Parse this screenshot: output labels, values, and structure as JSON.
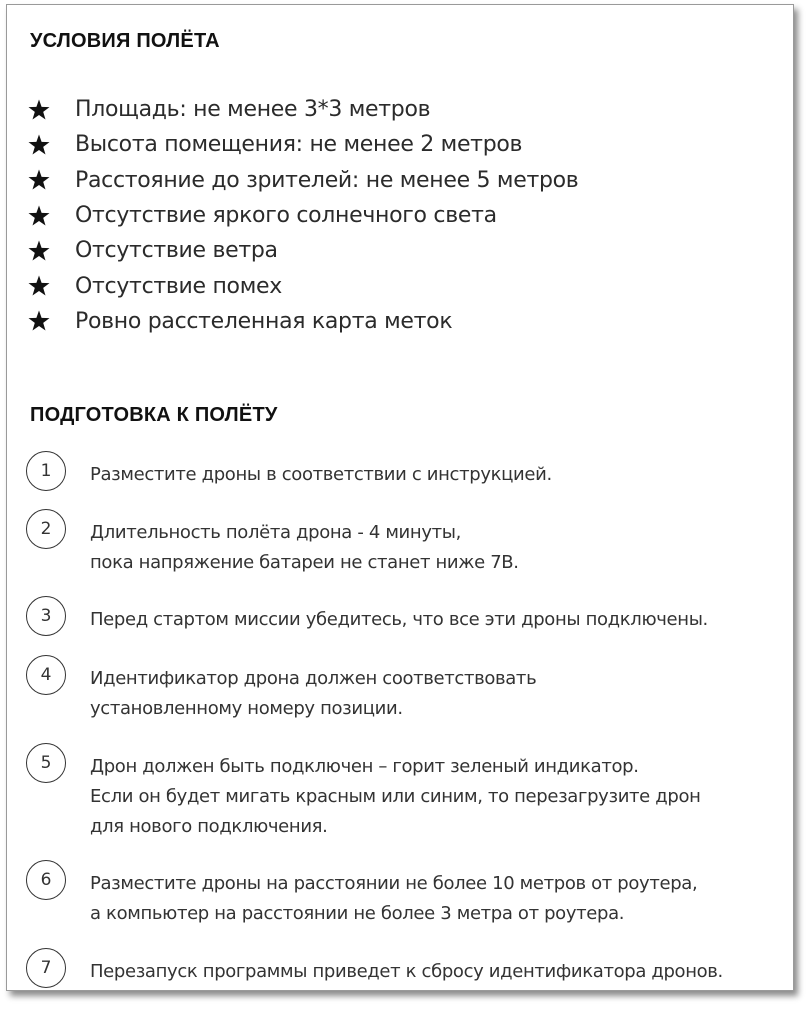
{
  "flight_conditions": {
    "title": "УСЛОВИЯ ПОЛЁТА",
    "icon": "star-icon",
    "items": [
      "Площадь: не менее 3*3 метров",
      "Высота помещения: не менее 2 метров",
      "Расстояние до зрителей: не менее 5 метров",
      "Отсутствие яркого солнечного света",
      "Отсутствие ветра",
      "Отсутствие помех",
      "Ровно расстеленная карта меток"
    ]
  },
  "flight_preparation": {
    "title": "ПОДГОТОВКА К ПОЛЁТУ",
    "steps": [
      {
        "number": "1",
        "lines": [
          "Разместите дроны в соответствии с инструкцией."
        ]
      },
      {
        "number": "2",
        "lines": [
          "Длительность полёта дрона - 4 минуты,",
          "пока напряжение батареи не станет ниже 7В."
        ]
      },
      {
        "number": "3",
        "lines": [
          "Перед стартом миссии убедитесь, что все эти дроны подключены."
        ]
      },
      {
        "number": "4",
        "lines": [
          "Идентификатор дрона должен соответствовать",
          "установленному номеру позиции."
        ]
      },
      {
        "number": "5",
        "lines": [
          "Дрон должен быть подключен – горит зеленый индикатор.",
          "Если он будет мигать красным или синим, то перезагрузите дрон",
          "для нового подключения."
        ]
      },
      {
        "number": "6",
        "lines": [
          "Разместите дроны на расстоянии не более 10 метров от роутера,",
          "а компьютер на расстоянии не более 3 метра от роутера."
        ]
      },
      {
        "number": "7",
        "lines": [
          "Перезапуск программы приведет к сбросу идентификатора дронов."
        ]
      }
    ]
  }
}
